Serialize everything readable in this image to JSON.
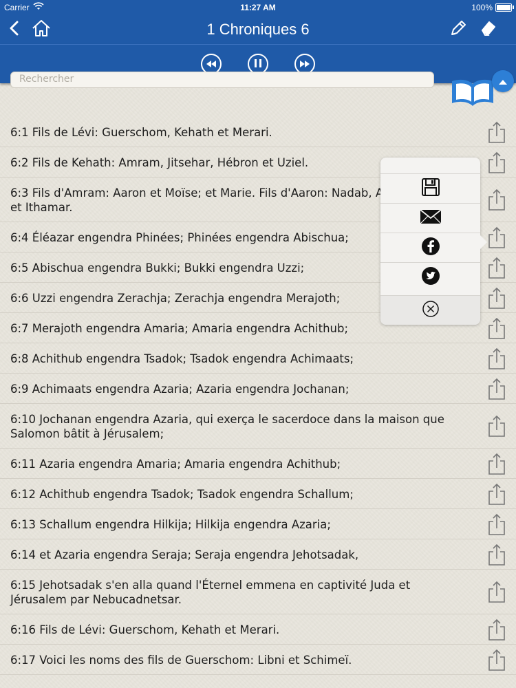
{
  "status_bar": {
    "carrier": "Carrier",
    "time": "11:27 AM",
    "battery": "100%"
  },
  "nav": {
    "title": "1 Chroniques 6",
    "back_icon": "chevron-left-icon",
    "home_icon": "home-icon",
    "edit_icon": "pencil-icon",
    "erase_icon": "eraser-icon"
  },
  "player": {
    "rewind_icon": "rewind-icon",
    "pause_icon": "pause-icon",
    "forward_icon": "fast-forward-icon"
  },
  "search": {
    "placeholder": "Rechercher"
  },
  "colors": {
    "accent": "#1f5aa8",
    "background": "#e9e6dd"
  },
  "verses": [
    {
      "text": "6:1 Fils de Lévi: Guerschom, Kehath et Merari."
    },
    {
      "text": "6:2 Fils de Kehath: Amram, Jitsehar, Hébron et Uziel."
    },
    {
      "text": "6:3 Fils d'Amram: Aaron et Moïse; et Marie. Fils d'Aaron: Nadab, Abihu, Éléazar et Ithamar."
    },
    {
      "text": "6:4 Éléazar engendra Phinées; Phinées engendra Abischua;"
    },
    {
      "text": "6:5 Abischua engendra Bukki; Bukki engendra Uzzi;"
    },
    {
      "text": "6:6 Uzzi engendra Zerachja; Zerachja engendra Merajoth;"
    },
    {
      "text": "6:7 Merajoth engendra Amaria; Amaria engendra Achithub;"
    },
    {
      "text": "6:8 Achithub engendra Tsadok; Tsadok engendra Achimaats;"
    },
    {
      "text": "6:9 Achimaats engendra Azaria; Azaria engendra Jochanan;"
    },
    {
      "text": "6:10 Jochanan engendra Azaria, qui exerça le sacerdoce dans la maison que Salomon bâtit à Jérusalem;"
    },
    {
      "text": "6:11 Azaria engendra Amaria; Amaria engendra Achithub;"
    },
    {
      "text": "6:12 Achithub engendra Tsadok; Tsadok engendra Schallum;"
    },
    {
      "text": "6:13 Schallum engendra Hilkija; Hilkija engendra Azaria;"
    },
    {
      "text": "6:14 et Azaria engendra Seraja; Seraja engendra Jehotsadak,"
    },
    {
      "text": "6:15 Jehotsadak s'en alla quand l'Éternel emmena en captivité Juda et Jérusalem par Nebucadnetsar."
    },
    {
      "text": "6:16 Fils de Lévi: Guerschom, Kehath et Merari."
    },
    {
      "text": "6:17 Voici les noms des fils de Guerschom: Libni et Schimeï."
    }
  ],
  "share_popup": {
    "items": [
      "save-icon",
      "email-icon",
      "facebook-icon",
      "twitter-icon",
      "close-circle-icon"
    ]
  }
}
